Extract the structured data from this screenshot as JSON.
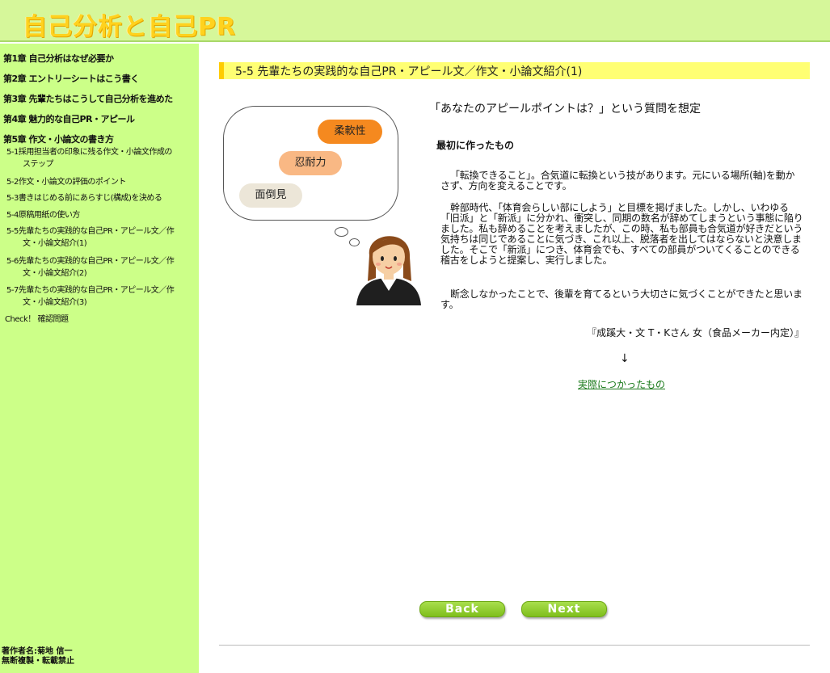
{
  "header": {
    "title": "自己分析と自己PR"
  },
  "sidebar": {
    "chapters": [
      "第1章 自己分析はなぜ必要か",
      "第2章 エントリーシートはこう書く",
      "第3章 先輩たちはこうして自己分析を進めた",
      "第4章 魅力的な自己PR・アピール",
      "第5章 作文・小論文の書き方"
    ],
    "items": [
      {
        "line1": "5-1採用担当者の印象に残る作文・小論文作成の",
        "line2": "ステップ"
      },
      {
        "line1": "5-2作文・小論文の評価のポイント",
        "line2": ""
      },
      {
        "line1": "5-3書きはじめる前にあらすじ(構成)を決める",
        "line2": ""
      },
      {
        "line1": "5-4原稿用紙の使い方",
        "line2": ""
      },
      {
        "line1": "5-5先輩たちの実践的な自己PR・アピール文／作",
        "line2": "文・小論文紹介(1)"
      },
      {
        "line1": "5-6先輩たちの実践的な自己PR・アピール文／作",
        "line2": "文・小論文紹介(2)"
      },
      {
        "line1": "5-7先輩たちの実践的な自己PR・アピール文／作",
        "line2": "文・小論文紹介(3)"
      }
    ],
    "check": "Check！ 確認問題",
    "author_line1": "著作者名:菊地 信一",
    "author_line2": "無断複製・転載禁止"
  },
  "main": {
    "section_title": "5-5 先輩たちの実践的な自己PR・アピール文／作文・小論文紹介(1)",
    "question": "「あなたのアピールポイントは？」という質問を想定",
    "subheading": "最初に作ったもの",
    "paragraphs": [
      "「転換できること」。合気道に転換という技があります。元にいる場所(軸)を動かさず、方向を変えることです。",
      "幹部時代、「体育会らしい部にしよう」と目標を掲げました。しかし、いわゆる「旧派」と「新派」に分かれ、衝突し、同期の数名が辞めてしまうという事態に陥りました。私も辞めることを考えましたが、この時、私も部員も合気道が好きだという気持ちは同じであることに気づき、これ以上、脱落者を出してはならないと決意しました。そこで「新派」につき、体育会でも、すべての部員がついてくることのできる稽古をしようと提案し、実行しました。",
      "断念しなかったことで、後輩を育てるという大切さに気づくことができたと思います。"
    ],
    "attribution": "『成蹊大・文 T・Kさん 女（食品メーカー内定）』",
    "arrow": "↓",
    "actual_link": "実際につかったもの"
  },
  "illustration": {
    "pills": [
      "柔軟性",
      "忍耐力",
      "面倒見"
    ],
    "colors": {
      "pill1": "#f5891f",
      "pill2": "#f9b884",
      "pill3": "#ece6d8"
    }
  },
  "nav": {
    "back": "Back",
    "next": "Next"
  },
  "colors": {
    "header_bg": "#d6f79a",
    "sidebar_bg": "#ccff88",
    "section_bar": "#ffff73",
    "button": "#8fcb2c"
  }
}
